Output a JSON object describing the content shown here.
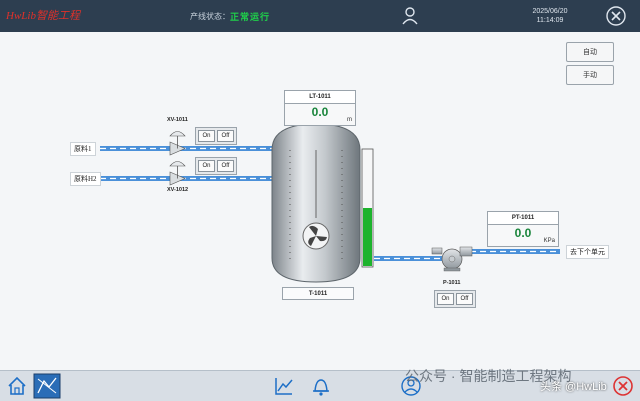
{
  "header": {
    "logo_text": "HwLib智能工程",
    "status_label": "产线状态：",
    "status_value": "正常运行",
    "date": "2025/06/20",
    "time": "11:14:09"
  },
  "mode_buttons": {
    "auto": "自动",
    "manual": "手动"
  },
  "level_transmitter": {
    "tag": "LT-1011",
    "value": "0.0",
    "unit": "m",
    "level_fraction": 0.5
  },
  "pressure_transmitter": {
    "tag": "PT-1011",
    "value": "0.0",
    "unit": "KPa"
  },
  "tank": {
    "tag": "T-1011"
  },
  "pump": {
    "tag": "P-1011",
    "on": "On",
    "off": "Off"
  },
  "valves": [
    {
      "tag": "XV-1011",
      "on": "On",
      "off": "Off"
    },
    {
      "tag": "XV-1012",
      "on": "On",
      "off": "Off"
    }
  ],
  "feeds": {
    "feed1": "原料1",
    "feed2": "原料H2",
    "outlet": "去下个单元"
  },
  "watermark": {
    "text1": "公众号 · 智能制造工程架构",
    "text2": "头条 @HwLib"
  },
  "colors": {
    "topbar": "#2d3e50",
    "status_ok": "#1fd14a",
    "level_fill": "#1db32d",
    "pipe": "#4a90d9"
  }
}
